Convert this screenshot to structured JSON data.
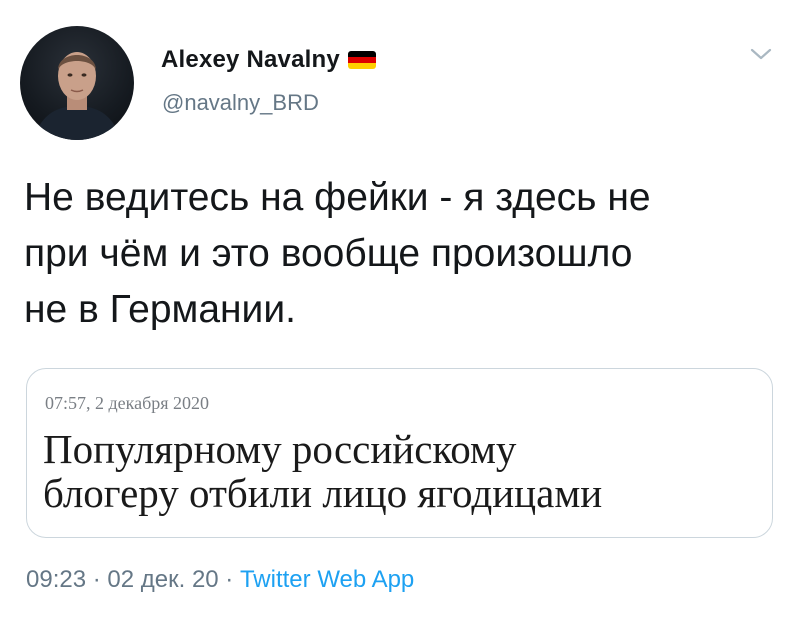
{
  "author": {
    "display_name": "Alexey Navalny",
    "handle": "@navalny_BRD",
    "flag_icon": "germany-flag-icon",
    "flag_colors": [
      "#000000",
      "#dd0000",
      "#ffce00"
    ]
  },
  "menu": {
    "icon": "chevron-down-icon"
  },
  "tweet": {
    "lines": [
      "Не ведитесь на фейки - я здесь не",
      "при чём и это вообще произошло",
      "не в Германии."
    ]
  },
  "quote": {
    "date": "07:57, 2 декабря 2020",
    "headline_lines": [
      "Популярному российскому",
      "блогеру отбили лицо ягодицами"
    ]
  },
  "meta": {
    "time": "09:23",
    "separator1": " · ",
    "date": "02 дек. 20",
    "separator2": " · ",
    "source": "Twitter Web App"
  },
  "colors": {
    "text": "#14171a",
    "secondary": "#657786",
    "link": "#1da1f2",
    "border": "#ccd6dd"
  }
}
